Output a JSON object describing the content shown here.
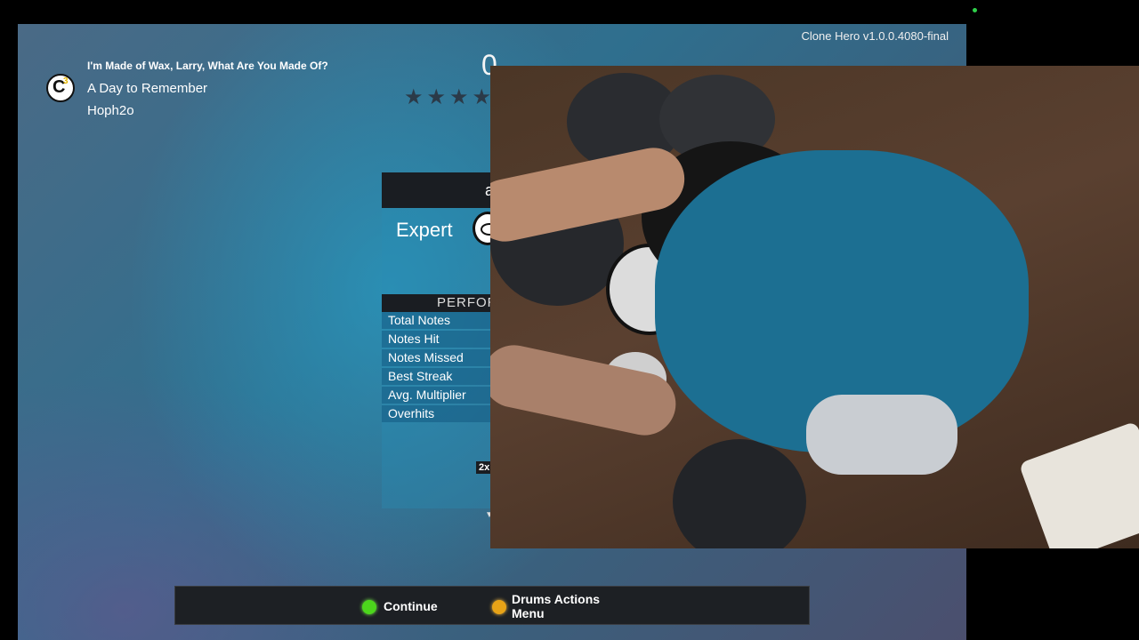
{
  "app": {
    "version": "Clone Hero v1.0.0.4080-final"
  },
  "song": {
    "logo_icon": "c3-logo",
    "name": "I'm Made of Wax, Larry, What Are You Made Of?",
    "artist": "A Day to Remember",
    "charter": "Hoph2o"
  },
  "score": {
    "value": "0",
    "stars_shown": 4,
    "stars_icon": "star-icon"
  },
  "results_panel": {
    "header_partial": "a",
    "difficulty": "Expert",
    "instrument_icon": "drum-icon",
    "performance_header": "PERFOR",
    "stats": [
      {
        "label": "Total Notes"
      },
      {
        "label": "Notes Hit"
      },
      {
        "label": "Notes Missed"
      },
      {
        "label": "Best Streak"
      },
      {
        "label": "Avg. Multiplier"
      },
      {
        "label": "Overhits"
      }
    ],
    "multiplier_badge": "2x"
  },
  "bottom_bar": {
    "continue": {
      "label": "Continue",
      "color": "#4cd61c"
    },
    "actions": {
      "label_line1": "Drums Actions",
      "label_line2": "Menu",
      "color": "#e8a317"
    }
  },
  "overlay": {
    "type": "webcam-feed",
    "subject": "drummer-overhead-view"
  }
}
